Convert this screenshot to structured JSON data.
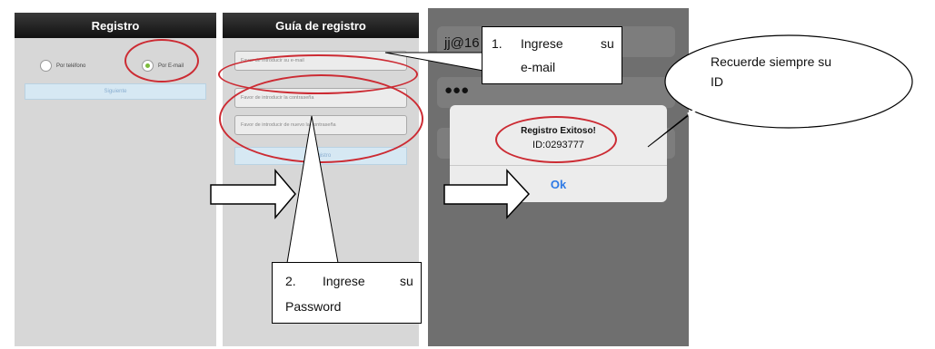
{
  "panel1": {
    "title": "Registro",
    "radio_phone": "Por teléfono",
    "radio_email": "Por E-mail",
    "next_button": "Siguiente"
  },
  "panel2": {
    "title": "Guía de registro",
    "email_placeholder": "Favor de introducir su e-mail",
    "password_placeholder": "Favor de introducir la contraseña",
    "password_confirm_placeholder": "Favor de introducir de nuevo la contraseña",
    "register_button": "Registro"
  },
  "panel3": {
    "email_value": "jj@16",
    "password_value": "●●●",
    "dialog_title": "Registro Exitoso!",
    "dialog_id": "ID:0293777",
    "ok_button": "Ok"
  },
  "callouts": {
    "step1_num": "1.",
    "step1_line1": "Ingrese",
    "step1_line1b": "su",
    "step1_line2": "e-mail",
    "step2_num": "2.",
    "step2_line1": "Ingrese",
    "step2_line1b": "su",
    "step2_line2": "Password",
    "remember_line1": "Recuerde siempre su",
    "remember_line2": "ID"
  },
  "colors": {
    "annotation_red": "#cc2b33",
    "ok_blue": "#2f7ae5"
  }
}
